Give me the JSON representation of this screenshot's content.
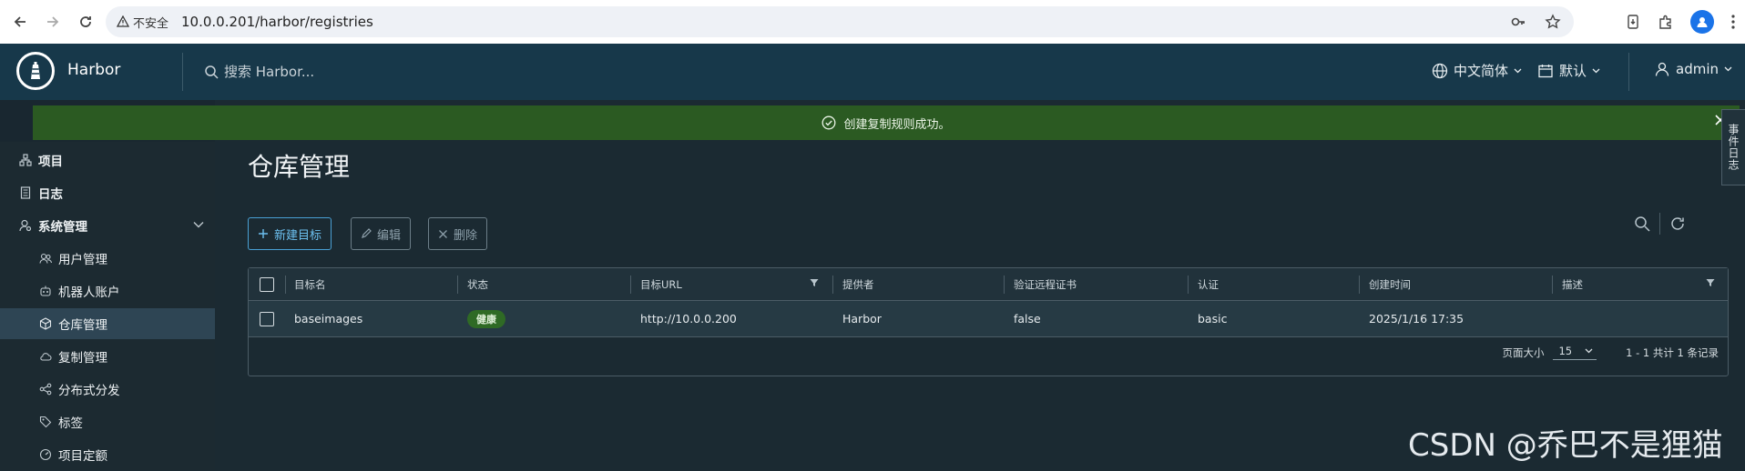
{
  "browser": {
    "security_label": "不安全",
    "url": "10.0.0.201/harbor/registries"
  },
  "header": {
    "brand": "Harbor",
    "search_placeholder": "搜索 Harbor...",
    "language": "中文简体",
    "date_format": "默认",
    "user": "admin"
  },
  "alert": {
    "message": "创建复制规则成功。"
  },
  "event_tab": "事件日志",
  "sidebar": {
    "items": [
      {
        "label": "项目"
      },
      {
        "label": "日志"
      },
      {
        "label": "系统管理"
      },
      {
        "label": "用户管理"
      },
      {
        "label": "机器人账户"
      },
      {
        "label": "仓库管理"
      },
      {
        "label": "复制管理"
      },
      {
        "label": "分布式分发"
      },
      {
        "label": "标签"
      },
      {
        "label": "项目定额"
      }
    ]
  },
  "main": {
    "title": "仓库管理",
    "buttons": {
      "new": "新建目标",
      "edit": "编辑",
      "delete": "删除"
    },
    "columns": [
      "目标名",
      "状态",
      "目标URL",
      "提供者",
      "验证远程证书",
      "认证",
      "创建时间",
      "描述"
    ],
    "rows": [
      {
        "name": "baseimages",
        "status": "健康",
        "url": "http://10.0.0.200",
        "provider": "Harbor",
        "verify_cert": "false",
        "auth": "basic",
        "created": "2025/1/16 17:35",
        "description": ""
      }
    ],
    "pagination": {
      "page_size_label": "页面大小",
      "page_size": "15",
      "summary": "1 - 1 共计 1 条记录"
    }
  },
  "watermark": "CSDN @乔巴不是狸猫",
  "colors": {
    "header_bg": "#17384a",
    "success_bg": "#2b5a22",
    "accent": "#49a0d4",
    "status_healthy": "#2f6a25"
  }
}
